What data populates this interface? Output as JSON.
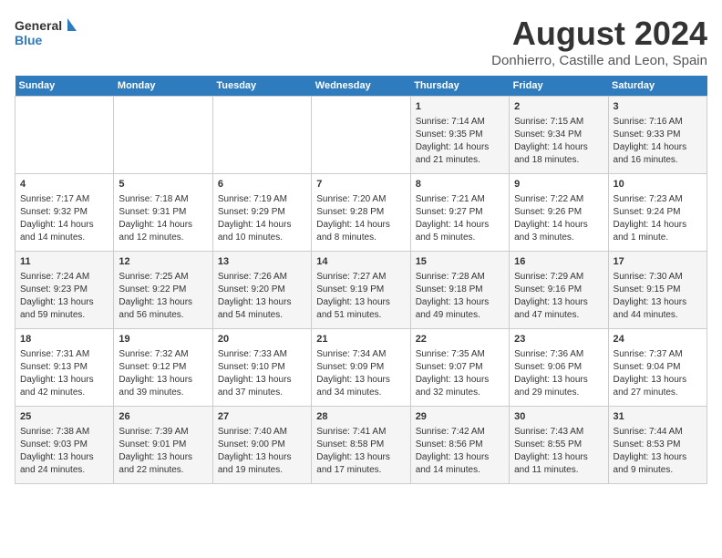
{
  "logo": {
    "general": "General",
    "blue": "Blue"
  },
  "title": "August 2024",
  "subtitle": "Donhierro, Castille and Leon, Spain",
  "days_of_week": [
    "Sunday",
    "Monday",
    "Tuesday",
    "Wednesday",
    "Thursday",
    "Friday",
    "Saturday"
  ],
  "weeks": [
    [
      {
        "day": "",
        "info": ""
      },
      {
        "day": "",
        "info": ""
      },
      {
        "day": "",
        "info": ""
      },
      {
        "day": "",
        "info": ""
      },
      {
        "day": "1",
        "info": "Sunrise: 7:14 AM\nSunset: 9:35 PM\nDaylight: 14 hours\nand 21 minutes."
      },
      {
        "day": "2",
        "info": "Sunrise: 7:15 AM\nSunset: 9:34 PM\nDaylight: 14 hours\nand 18 minutes."
      },
      {
        "day": "3",
        "info": "Sunrise: 7:16 AM\nSunset: 9:33 PM\nDaylight: 14 hours\nand 16 minutes."
      }
    ],
    [
      {
        "day": "4",
        "info": "Sunrise: 7:17 AM\nSunset: 9:32 PM\nDaylight: 14 hours\nand 14 minutes."
      },
      {
        "day": "5",
        "info": "Sunrise: 7:18 AM\nSunset: 9:31 PM\nDaylight: 14 hours\nand 12 minutes."
      },
      {
        "day": "6",
        "info": "Sunrise: 7:19 AM\nSunset: 9:29 PM\nDaylight: 14 hours\nand 10 minutes."
      },
      {
        "day": "7",
        "info": "Sunrise: 7:20 AM\nSunset: 9:28 PM\nDaylight: 14 hours\nand 8 minutes."
      },
      {
        "day": "8",
        "info": "Sunrise: 7:21 AM\nSunset: 9:27 PM\nDaylight: 14 hours\nand 5 minutes."
      },
      {
        "day": "9",
        "info": "Sunrise: 7:22 AM\nSunset: 9:26 PM\nDaylight: 14 hours\nand 3 minutes."
      },
      {
        "day": "10",
        "info": "Sunrise: 7:23 AM\nSunset: 9:24 PM\nDaylight: 14 hours\nand 1 minute."
      }
    ],
    [
      {
        "day": "11",
        "info": "Sunrise: 7:24 AM\nSunset: 9:23 PM\nDaylight: 13 hours\nand 59 minutes."
      },
      {
        "day": "12",
        "info": "Sunrise: 7:25 AM\nSunset: 9:22 PM\nDaylight: 13 hours\nand 56 minutes."
      },
      {
        "day": "13",
        "info": "Sunrise: 7:26 AM\nSunset: 9:20 PM\nDaylight: 13 hours\nand 54 minutes."
      },
      {
        "day": "14",
        "info": "Sunrise: 7:27 AM\nSunset: 9:19 PM\nDaylight: 13 hours\nand 51 minutes."
      },
      {
        "day": "15",
        "info": "Sunrise: 7:28 AM\nSunset: 9:18 PM\nDaylight: 13 hours\nand 49 minutes."
      },
      {
        "day": "16",
        "info": "Sunrise: 7:29 AM\nSunset: 9:16 PM\nDaylight: 13 hours\nand 47 minutes."
      },
      {
        "day": "17",
        "info": "Sunrise: 7:30 AM\nSunset: 9:15 PM\nDaylight: 13 hours\nand 44 minutes."
      }
    ],
    [
      {
        "day": "18",
        "info": "Sunrise: 7:31 AM\nSunset: 9:13 PM\nDaylight: 13 hours\nand 42 minutes."
      },
      {
        "day": "19",
        "info": "Sunrise: 7:32 AM\nSunset: 9:12 PM\nDaylight: 13 hours\nand 39 minutes."
      },
      {
        "day": "20",
        "info": "Sunrise: 7:33 AM\nSunset: 9:10 PM\nDaylight: 13 hours\nand 37 minutes."
      },
      {
        "day": "21",
        "info": "Sunrise: 7:34 AM\nSunset: 9:09 PM\nDaylight: 13 hours\nand 34 minutes."
      },
      {
        "day": "22",
        "info": "Sunrise: 7:35 AM\nSunset: 9:07 PM\nDaylight: 13 hours\nand 32 minutes."
      },
      {
        "day": "23",
        "info": "Sunrise: 7:36 AM\nSunset: 9:06 PM\nDaylight: 13 hours\nand 29 minutes."
      },
      {
        "day": "24",
        "info": "Sunrise: 7:37 AM\nSunset: 9:04 PM\nDaylight: 13 hours\nand 27 minutes."
      }
    ],
    [
      {
        "day": "25",
        "info": "Sunrise: 7:38 AM\nSunset: 9:03 PM\nDaylight: 13 hours\nand 24 minutes."
      },
      {
        "day": "26",
        "info": "Sunrise: 7:39 AM\nSunset: 9:01 PM\nDaylight: 13 hours\nand 22 minutes."
      },
      {
        "day": "27",
        "info": "Sunrise: 7:40 AM\nSunset: 9:00 PM\nDaylight: 13 hours\nand 19 minutes."
      },
      {
        "day": "28",
        "info": "Sunrise: 7:41 AM\nSunset: 8:58 PM\nDaylight: 13 hours\nand 17 minutes."
      },
      {
        "day": "29",
        "info": "Sunrise: 7:42 AM\nSunset: 8:56 PM\nDaylight: 13 hours\nand 14 minutes."
      },
      {
        "day": "30",
        "info": "Sunrise: 7:43 AM\nSunset: 8:55 PM\nDaylight: 13 hours\nand 11 minutes."
      },
      {
        "day": "31",
        "info": "Sunrise: 7:44 AM\nSunset: 8:53 PM\nDaylight: 13 hours\nand 9 minutes."
      }
    ]
  ]
}
